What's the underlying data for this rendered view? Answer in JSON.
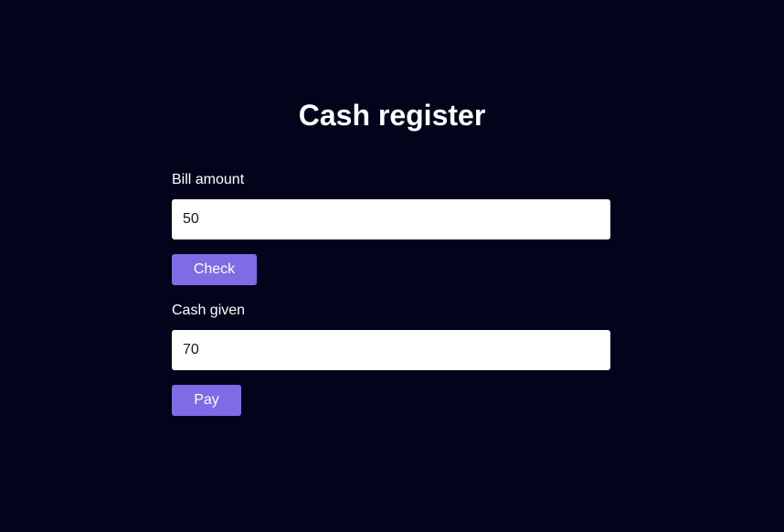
{
  "page": {
    "title": "Cash register"
  },
  "bill": {
    "label": "Bill amount",
    "value": "50",
    "check_label": "Check"
  },
  "cash": {
    "label": "Cash given",
    "value": "70",
    "pay_label": "Pay"
  },
  "colors": {
    "background": "#01041a",
    "button": "#7f6be6",
    "input_background": "#ffffff",
    "text": "#ffffff"
  }
}
